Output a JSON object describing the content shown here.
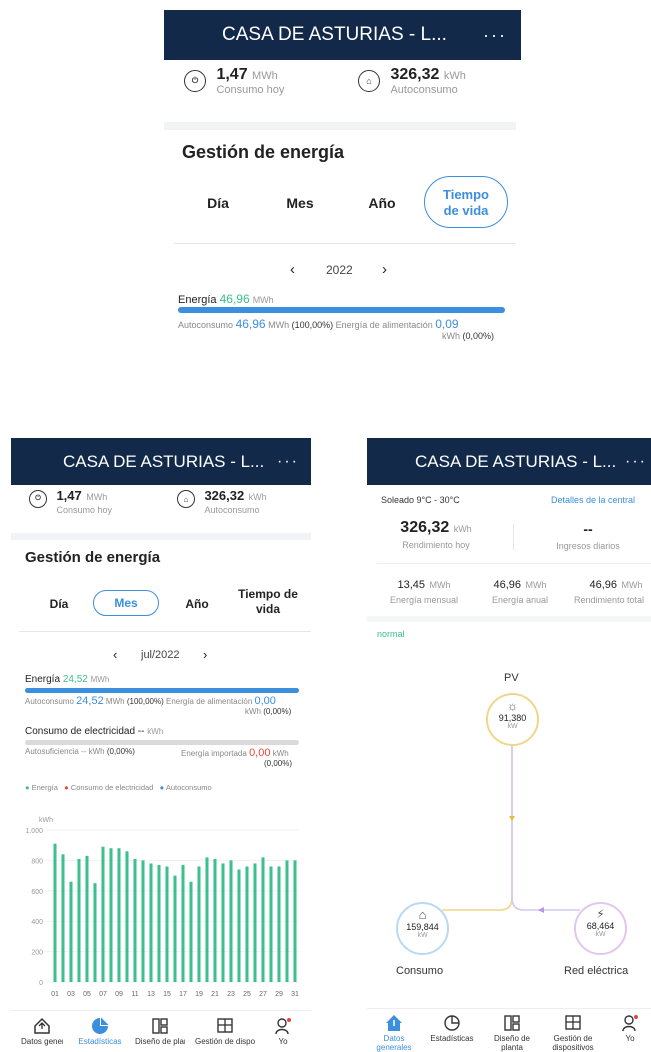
{
  "app": {
    "title": "CASA DE ASTURIAS - L...",
    "more_label": "···"
  },
  "summary": {
    "consumption_value": "1,47",
    "consumption_unit": "MWh",
    "consumption_label": "Consumo hoy",
    "self_value": "326,32",
    "self_unit": "kWh",
    "self_label": "Autoconsumo"
  },
  "energy_management": {
    "heading": "Gestión de energía",
    "tabs": [
      "Día",
      "Mes",
      "Año",
      "Tiempo de vida"
    ]
  },
  "panel_year": {
    "period": "2022",
    "energy_label": "Energía",
    "energy_value": "46,96",
    "energy_unit": "MWh",
    "self_label": "Autoconsumo",
    "self_value": "46,96",
    "self_unit": "MWh",
    "self_pct": "(100,00%)",
    "feed_label": "Energía de alimentación",
    "feed_value": "0,09",
    "feed_unit": "kWh",
    "feed_pct": "(0,00%)",
    "self_fraction": 1.0
  },
  "panel_month": {
    "period": "jul/2022",
    "energy_label": "Energía",
    "energy_value": "24,52",
    "energy_unit": "MWh",
    "self_label": "Autoconsumo",
    "self_value": "24,52",
    "self_unit": "MWh",
    "self_pct": "(100,00%)",
    "feed_label": "Energía de alimentación",
    "feed_value": "0,00",
    "feed_unit": "kWh",
    "feed_pct": "(0,00%)",
    "consumption_label": "Consumo de electricidad",
    "consumption_value": "--",
    "consumption_unit": "kWh",
    "sufficiency_label": "Autosuficiencia",
    "sufficiency_value": "--",
    "sufficiency_unit": "kWh",
    "sufficiency_pct": "(0,00%)",
    "import_label": "Energía importada",
    "import_value": "0,00",
    "import_unit": "kWh",
    "import_pct": "(0,00%)",
    "legend": [
      "Energía",
      "Consumo de electricidad",
      "Autoconsumo"
    ]
  },
  "overview": {
    "weather": "Soleado 9°C - 30°C",
    "details_link": "Detalles de la central",
    "yield_today_value": "326,32",
    "yield_today_unit": "kWh",
    "yield_today_label": "Rendimiento hoy",
    "daily_income_value": "--",
    "daily_income_label": "Ingresos diarios",
    "monthly_value": "13,45",
    "monthly_unit": "MWh",
    "monthly_label": "Energía mensual",
    "annual_value": "46,96",
    "annual_unit": "MWh",
    "annual_label": "Energía anual",
    "total_value": "46,96",
    "total_unit": "MWh",
    "total_label": "Rendimiento total",
    "status": "normal"
  },
  "flow": {
    "pv_label": "PV",
    "pv_value": "91,380",
    "pv_unit": "kW",
    "load_label": "Consumo",
    "load_value": "159,844",
    "load_unit": "kW",
    "grid_label": "Red eléctrica",
    "grid_value": "68,464",
    "grid_unit": "kW"
  },
  "nav_left": [
    "Datos generales",
    "Estadísticas",
    "Diseño de planta",
    "Gestión de dispositivos",
    "Yo"
  ],
  "nav_right": [
    "Datos generales",
    "Estadísticas",
    "Diseño de planta",
    "Gestión de dispositivos",
    "Yo"
  ],
  "colors": {
    "header": "#12294a",
    "accent": "#3c8fdc",
    "energy": "#3cc08c",
    "consumption": "#e5483a",
    "pv_ring": "#f0d68a",
    "grid_ring": "#e3c6ec",
    "load_ring": "#b9d8f4"
  },
  "chart_data": {
    "type": "bar",
    "ylabel": "kWh",
    "ylim": [
      0,
      1000
    ],
    "yticks": [
      "0",
      "200",
      "400",
      "600",
      "800",
      "1.000"
    ],
    "categories": [
      "01",
      "02",
      "03",
      "04",
      "05",
      "06",
      "07",
      "08",
      "09",
      "10",
      "11",
      "12",
      "13",
      "14",
      "15",
      "16",
      "17",
      "18",
      "19",
      "20",
      "21",
      "22",
      "23",
      "24",
      "25",
      "26",
      "27",
      "28",
      "29",
      "30",
      "31"
    ],
    "xtick_labels": [
      "01",
      "03",
      "05",
      "07",
      "09",
      "11",
      "13",
      "15",
      "17",
      "19",
      "21",
      "23",
      "25",
      "27",
      "29",
      "31"
    ],
    "series": [
      {
        "name": "Energía",
        "values": [
          910,
          840,
          660,
          810,
          830,
          650,
          890,
          880,
          880,
          860,
          810,
          800,
          780,
          770,
          760,
          700,
          770,
          660,
          760,
          820,
          810,
          780,
          800,
          740,
          760,
          780,
          820,
          760,
          760,
          800,
          800
        ]
      }
    ]
  }
}
